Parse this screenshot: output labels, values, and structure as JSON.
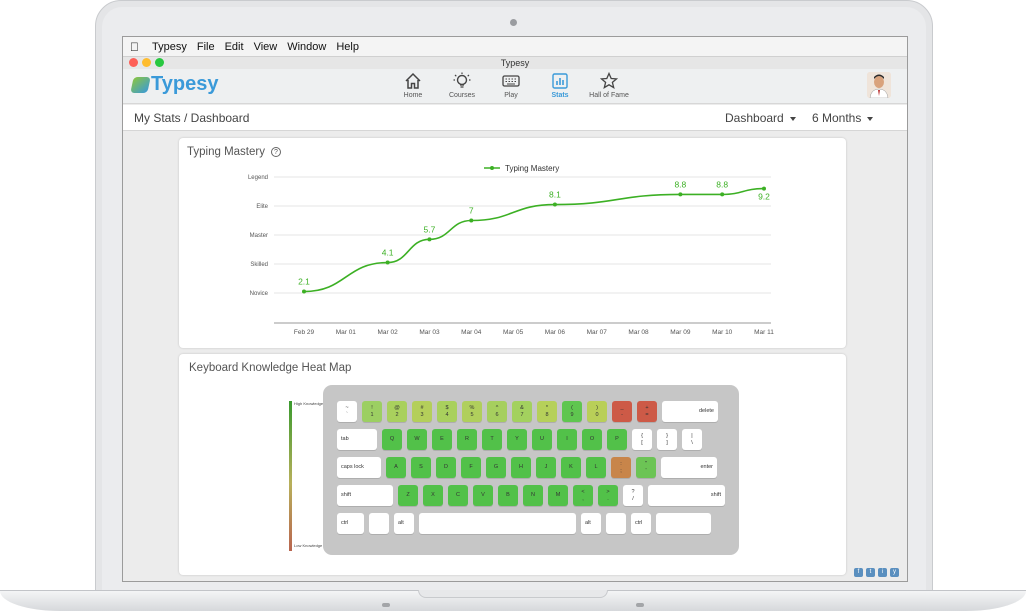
{
  "menubar": {
    "app": "Typesy",
    "items": [
      "File",
      "Edit",
      "View",
      "Window",
      "Help"
    ]
  },
  "window": {
    "title": "Typesy"
  },
  "brand": {
    "logo_text": "Typesy",
    "accent": "#3a9ad9",
    "green": "#8bc53f"
  },
  "nav": {
    "items": [
      {
        "label": "Home",
        "icon": "home-icon"
      },
      {
        "label": "Courses",
        "icon": "lightbulb-icon"
      },
      {
        "label": "Play",
        "icon": "keyboard-icon"
      },
      {
        "label": "Stats",
        "icon": "stats-icon",
        "active": true
      },
      {
        "label": "Hall of Fame",
        "icon": "star-icon"
      }
    ]
  },
  "breadcrumb": "My Stats / Dashboard",
  "view_select": {
    "value": "Dashboard"
  },
  "range_select": {
    "value": "6 Months"
  },
  "mastery_card": {
    "title": "Typing Mastery"
  },
  "chart_data": {
    "type": "line",
    "title": "Typing Mastery",
    "series": [
      {
        "name": "Typing Mastery",
        "color": "#3cb024",
        "x": [
          "Feb 29",
          "Mar 02",
          "Mar 03",
          "Mar 04",
          "Mar 06",
          "Mar 09",
          "Mar 10",
          "Mar 11"
        ],
        "values": [
          2.1,
          4.1,
          5.7,
          7,
          8.1,
          8.8,
          8.8,
          9.2
        ]
      }
    ],
    "x_ticks": [
      "Feb 29",
      "Mar 01",
      "Mar 02",
      "Mar 03",
      "Mar 04",
      "Mar 05",
      "Mar 06",
      "Mar 07",
      "Mar 08",
      "Mar 09",
      "Mar 10",
      "Mar 11"
    ],
    "y_tick_labels": [
      "Novice",
      "Skilled",
      "Master",
      "Elite",
      "Legend"
    ],
    "y_tick_values": [
      2,
      4,
      6,
      8,
      10
    ],
    "ylim": [
      2,
      10
    ],
    "legend": "top-center",
    "grid": true
  },
  "heatmap_card": {
    "title": "Keyboard Knowledge Heat Map"
  },
  "heat_legend": {
    "high": "High Knowledge",
    "low": "Low Knowledge"
  },
  "keyboard": {
    "row1": [
      {
        "t": "~",
        "b": "`",
        "c": "#ffffff"
      },
      {
        "t": "!",
        "b": "1",
        "c": "#9ccf62"
      },
      {
        "t": "@",
        "b": "2",
        "c": "#a9d05d"
      },
      {
        "t": "#",
        "b": "3",
        "c": "#b4cf5a"
      },
      {
        "t": "$",
        "b": "4",
        "c": "#a9d05d"
      },
      {
        "t": "%",
        "b": "5",
        "c": "#b0cf5c"
      },
      {
        "t": "^",
        "b": "6",
        "c": "#a6cf5e"
      },
      {
        "t": "&",
        "b": "7",
        "c": "#a3d15e"
      },
      {
        "t": "*",
        "b": "8",
        "c": "#b6d05a"
      },
      {
        "t": "(",
        "b": "9",
        "c": "#5fc64f"
      },
      {
        "t": ")",
        "b": "0",
        "c": "#b9cf58"
      },
      {
        "t": "_",
        "b": "-",
        "c": "#cd5a47"
      },
      {
        "t": "+",
        "b": "=",
        "c": "#cd5a47"
      },
      {
        "t": "",
        "b": "delete",
        "c": "#ffffff"
      }
    ],
    "row2": [
      {
        "t": "",
        "b": "tab",
        "c": "#ffffff"
      },
      {
        "t": "",
        "b": "Q",
        "c": "#52c149"
      },
      {
        "t": "",
        "b": "W",
        "c": "#52c149"
      },
      {
        "t": "",
        "b": "E",
        "c": "#52c149"
      },
      {
        "t": "",
        "b": "R",
        "c": "#52c149"
      },
      {
        "t": "",
        "b": "T",
        "c": "#52c149"
      },
      {
        "t": "",
        "b": "Y",
        "c": "#52c149"
      },
      {
        "t": "",
        "b": "U",
        "c": "#52c149"
      },
      {
        "t": "",
        "b": "I",
        "c": "#52c149"
      },
      {
        "t": "",
        "b": "O",
        "c": "#52c149"
      },
      {
        "t": "",
        "b": "P",
        "c": "#52c149"
      },
      {
        "t": "{",
        "b": "[",
        "c": "#ffffff"
      },
      {
        "t": "}",
        "b": "]",
        "c": "#ffffff"
      },
      {
        "t": "|",
        "b": "\\",
        "c": "#ffffff"
      }
    ],
    "row3": [
      {
        "t": "",
        "b": "caps lock",
        "c": "#ffffff"
      },
      {
        "t": "",
        "b": "A",
        "c": "#52c149"
      },
      {
        "t": "",
        "b": "S",
        "c": "#52c149"
      },
      {
        "t": "",
        "b": "D",
        "c": "#52c149"
      },
      {
        "t": "",
        "b": "F",
        "c": "#52c149"
      },
      {
        "t": "",
        "b": "G",
        "c": "#52c149"
      },
      {
        "t": "",
        "b": "H",
        "c": "#52c149"
      },
      {
        "t": "",
        "b": "J",
        "c": "#52c149"
      },
      {
        "t": "",
        "b": "K",
        "c": "#52c149"
      },
      {
        "t": "",
        "b": "L",
        "c": "#52c149"
      },
      {
        "t": ":",
        "b": ";",
        "c": "#c8854a"
      },
      {
        "t": "\"",
        "b": "'",
        "c": "#6cc455"
      },
      {
        "t": "",
        "b": "enter",
        "c": "#ffffff"
      }
    ],
    "row4": [
      {
        "t": "",
        "b": "shift",
        "c": "#ffffff"
      },
      {
        "t": "",
        "b": "Z",
        "c": "#52c149"
      },
      {
        "t": "",
        "b": "X",
        "c": "#52c149"
      },
      {
        "t": "",
        "b": "C",
        "c": "#52c149"
      },
      {
        "t": "",
        "b": "V",
        "c": "#52c149"
      },
      {
        "t": "",
        "b": "B",
        "c": "#52c149"
      },
      {
        "t": "",
        "b": "N",
        "c": "#52c149"
      },
      {
        "t": "",
        "b": "M",
        "c": "#52c149"
      },
      {
        "t": "<",
        "b": ",",
        "c": "#52c149"
      },
      {
        "t": ">",
        "b": ".",
        "c": "#52c149"
      },
      {
        "t": "?",
        "b": "/",
        "c": "#ffffff"
      },
      {
        "t": "",
        "b": "shift",
        "c": "#ffffff"
      }
    ],
    "row5": [
      {
        "t": "",
        "b": "ctrl",
        "c": "#ffffff"
      },
      {
        "t": "",
        "b": "",
        "c": "#ffffff"
      },
      {
        "t": "",
        "b": "alt",
        "c": "#ffffff"
      },
      {
        "t": "",
        "b": "",
        "c": "#ffffff"
      },
      {
        "t": "",
        "b": "alt",
        "c": "#ffffff"
      },
      {
        "t": "",
        "b": "",
        "c": "#ffffff"
      },
      {
        "t": "",
        "b": "ctrl",
        "c": "#ffffff"
      },
      {
        "t": "",
        "b": "",
        "c": "#ffffff"
      }
    ]
  },
  "social": [
    "f",
    "t",
    "i",
    "y"
  ]
}
